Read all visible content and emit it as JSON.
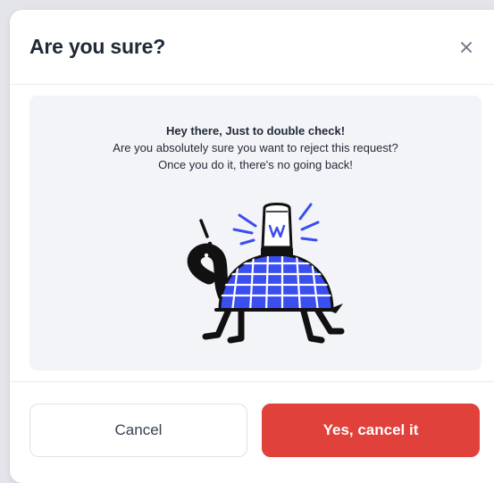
{
  "dialog": {
    "title": "Are you sure?",
    "close_icon": "close-icon",
    "message": {
      "line1": "Hey there, Just to double check!",
      "line2": "Are you absolutely sure you want to reject this request?",
      "line3": "Once you do it, there's no going back!"
    },
    "illustration_icon": "turtle-illustration",
    "buttons": {
      "cancel_label": "Cancel",
      "confirm_label": "Yes, cancel it"
    }
  },
  "colors": {
    "confirm": "#e0413a",
    "accent_blue": "#3b4ef0",
    "title_text": "#1f2937",
    "panel_bg": "#f3f4f7"
  }
}
